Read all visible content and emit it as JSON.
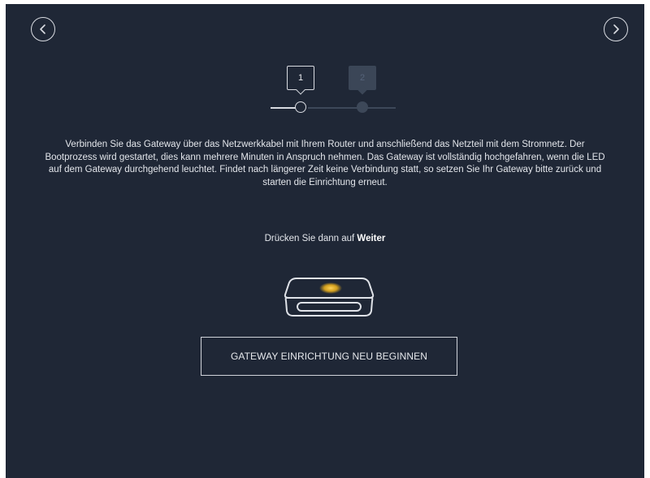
{
  "wizard": {
    "steps": [
      {
        "number": "1",
        "state": "active"
      },
      {
        "number": "2",
        "state": "inactive"
      }
    ],
    "current_step": 1,
    "total_steps": 2
  },
  "content": {
    "instructions": "Verbinden Sie das Gateway über das Netzwerkkabel mit Ihrem Router und anschließend das Netzteil mit dem Stromnetz. Der Bootprozess wird gestartet, dies kann mehrere Minuten in Anspruch nehmen. Das Gateway ist vollständig hochgefahren, wenn die LED auf dem Gateway durchgehend leuchtet. Findet nach längerer Zeit keine Verbindung statt, so setzen Sie Ihr Gateway bitte zurück und starten die Einrichtung erneut.",
    "hint_prefix": "Drücken Sie dann auf",
    "hint_emphasis": "Weiter"
  },
  "actions": {
    "reset_label": "GATEWAY EINRICHTUNG NEU BEGINNEN"
  },
  "navigation": {
    "prev_icon": "chevron-left-circle-icon",
    "next_icon": "chevron-right-circle-icon"
  },
  "colors": {
    "background": "#1f2736",
    "foreground": "#e6e8ec",
    "inactive": "#3b4657",
    "led": "#f2b51b"
  }
}
